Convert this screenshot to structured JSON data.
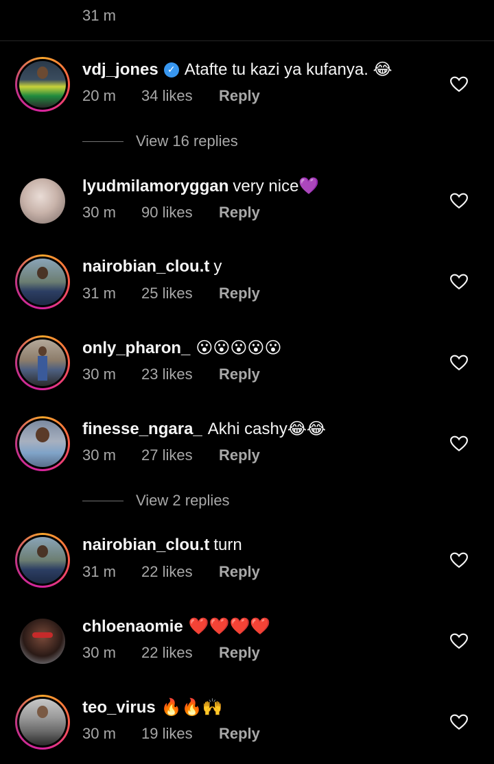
{
  "top_time": "31 m",
  "comments": [
    {
      "username": "vdj_jones",
      "verified": true,
      "text": "Atafte tu kazi ya kufanya. 😂",
      "time": "20 m",
      "likes": "34 likes",
      "reply": "Reply"
    },
    {
      "username": "lyudmilamoryggan",
      "verified": false,
      "text": "very nice💜",
      "time": "30 m",
      "likes": "90 likes",
      "reply": "Reply"
    },
    {
      "username": "nairobian_clou.t",
      "verified": false,
      "text": "y",
      "time": "31 m",
      "likes": "25 likes",
      "reply": "Reply"
    },
    {
      "username": "only_pharon_",
      "verified": false,
      "text": "😮😮😮😮😮",
      "time": "30 m",
      "likes": "23 likes",
      "reply": "Reply"
    },
    {
      "username": "finesse_ngara_",
      "verified": false,
      "text": "Akhi cashy😂😂",
      "time": "30 m",
      "likes": "27 likes",
      "reply": "Reply"
    },
    {
      "username": "nairobian_clou.t",
      "verified": false,
      "text": "turn",
      "time": "31 m",
      "likes": "22 likes",
      "reply": "Reply"
    },
    {
      "username": "chloenaomie",
      "verified": false,
      "text": "❤️❤️❤️❤️",
      "time": "30 m",
      "likes": "22 likes",
      "reply": "Reply"
    },
    {
      "username": "teo_virus",
      "verified": false,
      "text": "🔥🔥🙌",
      "time": "30 m",
      "likes": "19 likes",
      "reply": "Reply"
    }
  ],
  "view_replies_1": "View 16 replies",
  "view_replies_2": "View 2 replies",
  "colors": {
    "background": "#000000",
    "text": "#f5f5f5",
    "secondary": "#a8a8a8",
    "verified": "#3897f0"
  }
}
